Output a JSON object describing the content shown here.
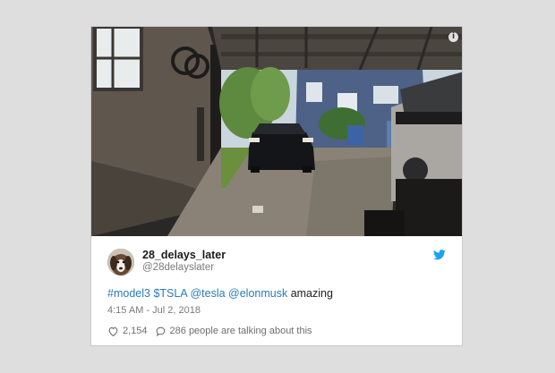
{
  "tweet": {
    "author_name": "28_delays_later",
    "author_handle": "@28delayslater",
    "text_parts": [
      {
        "text": "#model3",
        "link": true
      },
      {
        "text": " ",
        "link": false
      },
      {
        "text": "$TSLA",
        "link": true
      },
      {
        "text": " ",
        "link": false
      },
      {
        "text": "@tesla",
        "link": true
      },
      {
        "text": " ",
        "link": false
      },
      {
        "text": "@elonmusk",
        "link": true
      },
      {
        "text": " amazing",
        "link": false
      }
    ],
    "timestamp": "4:15 AM - Jul 2, 2018",
    "likes": "2,154",
    "replies_text": "286 people are talking about this"
  },
  "icons": {
    "info": "info-icon",
    "brand": "twitter-bird-icon",
    "like": "heart-icon",
    "reply": "speech-bubble-icon"
  },
  "colors": {
    "link": "#2b7bb9",
    "twitter_blue": "#1da1f2",
    "page_bg": "#dedede"
  },
  "info_glyph": "i"
}
